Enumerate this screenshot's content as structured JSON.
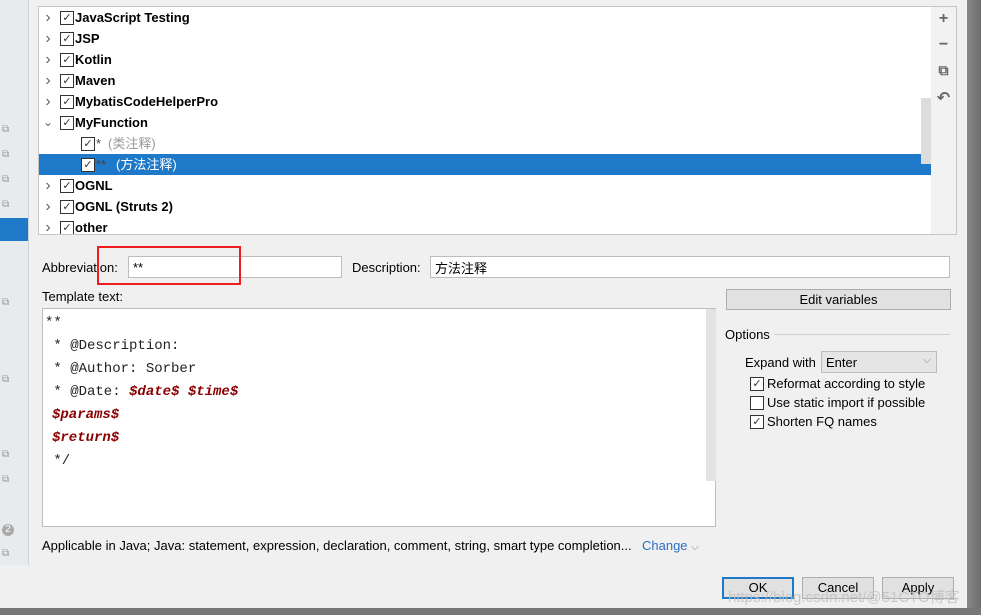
{
  "tree": {
    "items": [
      {
        "label": "JavaScript Testing",
        "expanded": false,
        "checked": true
      },
      {
        "label": "JSP",
        "expanded": false,
        "checked": true
      },
      {
        "label": "Kotlin",
        "expanded": false,
        "checked": true
      },
      {
        "label": "Maven",
        "expanded": false,
        "checked": true
      },
      {
        "label": "MybatisCodeHelperPro",
        "expanded": false,
        "checked": true
      },
      {
        "label": "MyFunction",
        "expanded": true,
        "checked": true
      },
      {
        "label": "*",
        "desc": "(类注释)",
        "checked": true,
        "child": true
      },
      {
        "label": "**",
        "desc": "(方法注释)",
        "checked": true,
        "child": true,
        "selected": true
      },
      {
        "label": "OGNL",
        "expanded": false,
        "checked": true
      },
      {
        "label": "OGNL (Struts 2)",
        "expanded": false,
        "checked": true
      },
      {
        "label": "other",
        "expanded": false,
        "checked": true
      }
    ]
  },
  "toolbar": {
    "add": "+",
    "remove": "−",
    "copy": "⧉",
    "revert": "↶"
  },
  "form": {
    "abbreviation_label": "Abbreviation:",
    "abbreviation": "**",
    "description_label": "Description:",
    "description": "方法注释",
    "template_label": "Template text:"
  },
  "template": {
    "lines": [
      "**",
      " * @Description:",
      " * @Author: Sorber",
      " * @Date: ",
      "$date$ $time$",
      "$params$",
      "$return$",
      " */"
    ]
  },
  "options": {
    "edit_variables": "Edit variables",
    "title": "Options",
    "expand_label": "Expand with",
    "expand_value": "Enter",
    "reformat": "Reformat according to style",
    "reformat_checked": true,
    "static_import": "Use static import if possible",
    "static_import_checked": false,
    "shorten": "Shorten FQ names",
    "shorten_checked": true
  },
  "applicable": {
    "text": "Applicable in Java; Java: statement, expression, declaration, comment, string, smart type completion...",
    "change": "Change"
  },
  "buttons": {
    "ok": "OK",
    "cancel": "Cancel",
    "apply": "Apply"
  },
  "watermark": "https://blog.csdn.net/@51CTO博客",
  "colors": {
    "selection": "#1e7ac8",
    "variable": "#8b0000",
    "highlight": "#ee1c1c",
    "link": "#2a6fc9"
  }
}
